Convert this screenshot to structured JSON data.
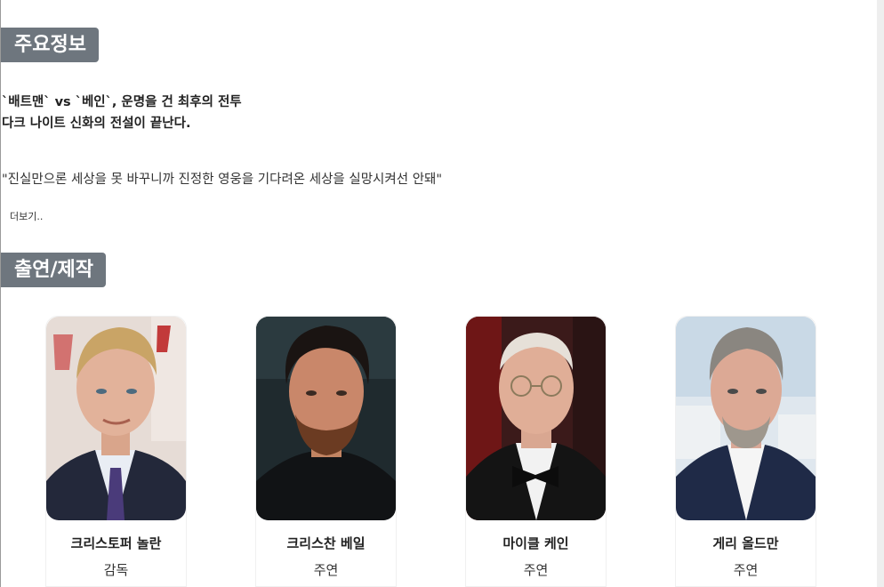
{
  "sections": {
    "info_heading": "주요정보",
    "cast_heading": "출연/제작"
  },
  "synopsis": {
    "tagline_line1": "`배트맨` vs `베인`, 운명을 건 최후의 전투",
    "tagline_line2": "다크 나이트 신화의 전설이 끝난다.",
    "quote": "\"진실만으론 세상을 못 바꾸니까 진정한 영웅을 기다려온 세상을 실망시켜선 안돼\"",
    "more_label": "더보기.."
  },
  "cast": [
    {
      "name": "크리스토퍼 놀란",
      "role": "감독",
      "photo_icon": "person-photo"
    },
    {
      "name": "크리스찬 베일",
      "role": "주연",
      "photo_icon": "person-photo"
    },
    {
      "name": "마이클 케인",
      "role": "주연",
      "photo_icon": "person-photo"
    },
    {
      "name": "게리 올드만",
      "role": "주연",
      "photo_icon": "person-photo"
    }
  ],
  "colors": {
    "heading_bg": "#6e767e",
    "heading_text": "#ffffff"
  }
}
